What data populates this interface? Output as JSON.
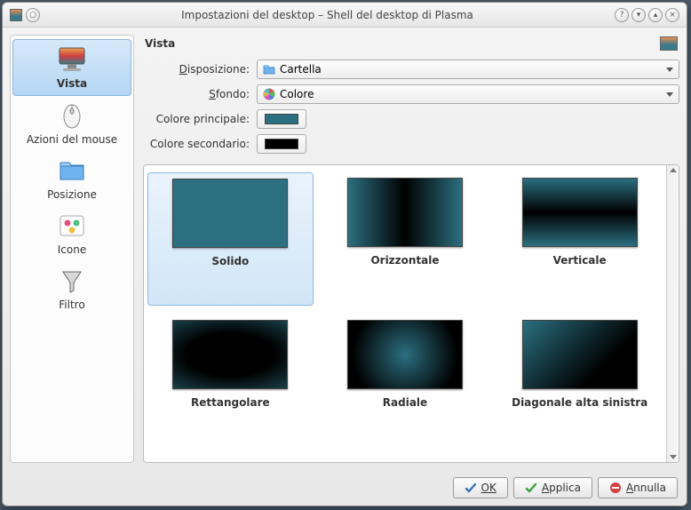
{
  "window": {
    "title": "Impostazioni del desktop – Shell del desktop di Plasma"
  },
  "sidebar": {
    "items": [
      {
        "id": "vista",
        "label": "Vista",
        "selected": true
      },
      {
        "id": "mouse",
        "label": "Azioni del mouse",
        "selected": false
      },
      {
        "id": "posizione",
        "label": "Posizione",
        "selected": false
      },
      {
        "id": "icone",
        "label": "Icone",
        "selected": false
      },
      {
        "id": "filtro",
        "label": "Filtro",
        "selected": false
      }
    ]
  },
  "main": {
    "title": "Vista",
    "disposizione": {
      "label": "Disposizione:",
      "value": "Cartella"
    },
    "sfondo": {
      "label": "Sfondo:",
      "value": "Colore"
    },
    "colore_principale": {
      "label": "Colore principale:",
      "value": "#2b6f80"
    },
    "colore_secondario": {
      "label": "Colore secondario:",
      "value": "#000000"
    }
  },
  "gallery": {
    "selected": "solido",
    "items": [
      {
        "id": "solido",
        "label": "Solido"
      },
      {
        "id": "orizzontale",
        "label": "Orizzontale"
      },
      {
        "id": "verticale",
        "label": "Verticale"
      },
      {
        "id": "rettangolare",
        "label": "Rettangolare"
      },
      {
        "id": "radiale",
        "label": "Radiale"
      },
      {
        "id": "diagonale_as",
        "label": "Diagonale alta sinistra"
      }
    ]
  },
  "buttons": {
    "ok": "OK",
    "apply": "Applica",
    "cancel": "Annulla"
  }
}
